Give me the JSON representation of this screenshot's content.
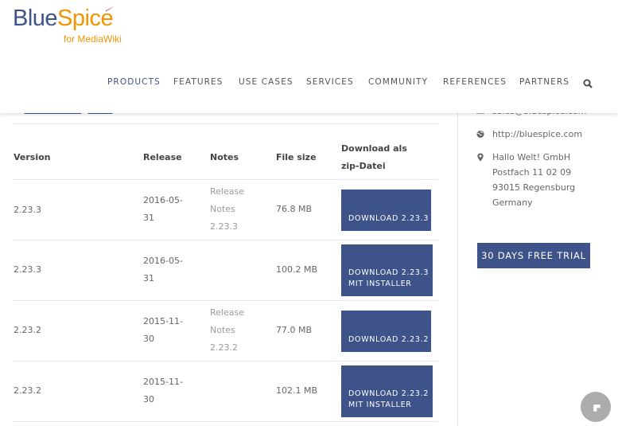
{
  "logo": {
    "main_blue": "Blue",
    "main_orange": "Spice",
    "sub": "for MediaWiki"
  },
  "nav": {
    "items": [
      {
        "label": "PRODUCTS",
        "active": true
      },
      {
        "label": "FEATURES",
        "active": false
      },
      {
        "label": "USE CASES",
        "active": false
      },
      {
        "label": "SERVICES",
        "active": false
      },
      {
        "label": "COMMUNITY",
        "active": false
      },
      {
        "label": "REFERENCES",
        "active": false
      },
      {
        "label": "PARTNERS",
        "active": false
      }
    ],
    "search_icon": "search-icon"
  },
  "table": {
    "headers": {
      "version": "Version",
      "release": "Release",
      "notes": "Notes",
      "file_size": "File size",
      "download_line1": "Download als",
      "download_line2": "zip-Datei"
    },
    "rows": [
      {
        "version": "2.23.3",
        "release": [
          "2016-05-",
          "31"
        ],
        "notes": [
          "Release",
          "Notes",
          "2.23.3"
        ],
        "size": "76.8 MB",
        "button": [
          "DOWNLOAD 2.23.3"
        ]
      },
      {
        "version": "2.23.3",
        "release": [
          "2016-05-",
          "31"
        ],
        "notes": [],
        "size": "100.2 MB",
        "button": [
          "DOWNLOAD 2.23.3",
          "MIT INSTALLER"
        ]
      },
      {
        "version": "2.23.2",
        "release": [
          "2015-11-",
          "30"
        ],
        "notes": [
          "Release",
          "Notes",
          "2.23.2"
        ],
        "size": "77.0 MB",
        "button": [
          "DOWNLOAD 2.23.2"
        ]
      },
      {
        "version": "2.23.2",
        "release": [
          "2015-11-",
          "30"
        ],
        "notes": [],
        "size": "102.1 MB",
        "button": [
          "DOWNLOAD 2.23.2",
          "MIT INSTALLER"
        ]
      }
    ]
  },
  "sidebar": {
    "email": "sales@bluespice.com",
    "website": "http://bluespice.com",
    "address": [
      "Hallo Welt! GmbH",
      "Postfach 11 02 09",
      "93015 Regensburg",
      "Germany"
    ],
    "trial_label": "30 DAYS FREE TRIAL"
  },
  "colors": {
    "brand_blue": "#3e5389",
    "brand_orange": "#f29400",
    "text": "#666666",
    "muted": "#9a9a9a"
  }
}
